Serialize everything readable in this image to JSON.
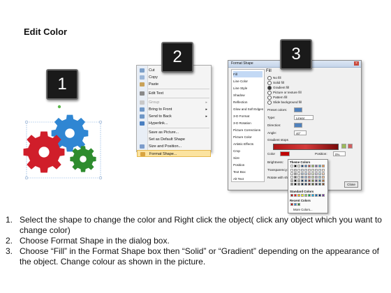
{
  "title": "Edit Color",
  "badges": [
    "1",
    "2",
    "3"
  ],
  "colors": {
    "gear_red": "#d01e2a",
    "gear_blue": "#2f86d3",
    "gear_green": "#2e8c2e",
    "badge_bg": "#1a1a1a",
    "highlight": "#fbe3a0"
  },
  "context_menu": {
    "items": [
      {
        "label": "Cut",
        "icon": "cut-icon"
      },
      {
        "label": "Copy",
        "icon": "copy-icon"
      },
      {
        "label": "Paste",
        "icon": "paste-icon"
      },
      {
        "label": "Edit Text",
        "icon": "edit-text-icon"
      },
      {
        "label": "Group",
        "icon": "group-icon",
        "disabled": true
      },
      {
        "label": "Bring to Front",
        "icon": "bring-front-icon",
        "submenu": true
      },
      {
        "label": "Send to Back",
        "icon": "send-back-icon",
        "submenu": true
      },
      {
        "label": "Hyperlink...",
        "icon": "hyperlink-icon"
      },
      {
        "label": "Save as Picture...",
        "icon": ""
      },
      {
        "label": "Set as Default Shape",
        "icon": ""
      },
      {
        "label": "Size and Position...",
        "icon": "size-icon"
      },
      {
        "label": "Format Shape...",
        "icon": "format-icon",
        "highlighted": true
      }
    ]
  },
  "dialog": {
    "title": "Format Shape",
    "nav": [
      "Fill",
      "Line Color",
      "Line Style",
      "Shadow",
      "Reflection",
      "Glow and Soft Edges",
      "3-D Format",
      "3-D Rotation",
      "Picture Corrections",
      "Picture Color",
      "Artistic Effects",
      "Crop",
      "Size",
      "Position",
      "Text Box",
      "Alt Text"
    ],
    "heading": "Fill",
    "options": [
      {
        "label": "No fill",
        "checked": false
      },
      {
        "label": "Solid fill",
        "checked": false
      },
      {
        "label": "Gradient fill",
        "checked": true
      },
      {
        "label": "Picture or texture fill",
        "checked": false
      },
      {
        "label": "Pattern fill",
        "checked": false
      },
      {
        "label": "Slide background fill",
        "checked": false
      }
    ],
    "preset_label": "Preset colors:",
    "type_label": "Type:",
    "type_value": "Linear",
    "direction_label": "Direction:",
    "angle_label": "Angle:",
    "angle_value": "40°",
    "stops_label": "Gradient stops",
    "color_label": "Color",
    "position_label": "Position:",
    "position_value": "0%",
    "brightness_label": "Brightness:",
    "transparency_label": "Transparency:",
    "rotate_label": "Rotate with shape",
    "close_label": "Close"
  },
  "palette": {
    "theme_caption": "Theme Colors",
    "standard_caption": "Standard Colors",
    "recent_caption": "Recent Colors",
    "more_label": "More Colors...",
    "theme_top": [
      "#ffffff",
      "#000000",
      "#eeece1",
      "#1f497d",
      "#4f81bd",
      "#c0504d",
      "#9bbb59",
      "#8064a2",
      "#4bacc6",
      "#f79646"
    ],
    "standard": [
      "#c00000",
      "#ff0000",
      "#ffc000",
      "#ffff00",
      "#92d050",
      "#00b050",
      "#00b0f0",
      "#0070c0",
      "#002060",
      "#7030a0"
    ],
    "recent": [
      "#c00000",
      "#2f86d3",
      "#2e8c2e"
    ]
  },
  "steps": [
    {
      "num": "1.",
      "text": "Select the shape to change the color and Right click the object( click any object which you want to change color)"
    },
    {
      "num": "2.",
      "text": "Choose Format Shape in the dialog box."
    },
    {
      "num": "3.",
      "text": "Choose “Fill” in the Format Shape box then “Solid” or “Gradient” depending on the appearance of the object. Change colour as shown in the picture."
    }
  ]
}
